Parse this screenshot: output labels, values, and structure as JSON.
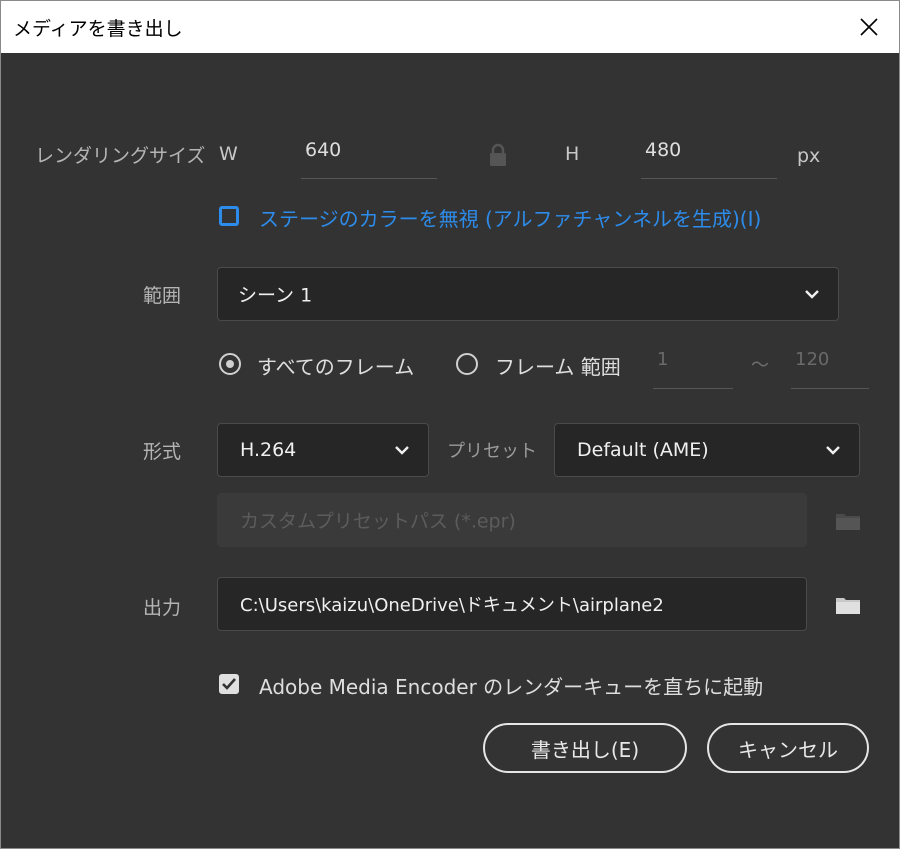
{
  "window": {
    "title": "メディアを書き出し",
    "close_glyph": "✕"
  },
  "render_size": {
    "label": "レンダリングサイズ",
    "w_label": "W",
    "w_value": "640",
    "h_label": "H",
    "h_value": "480",
    "unit": "px"
  },
  "ignore_stage_color": {
    "label": "ステージのカラーを無視 (アルファチャンネルを生成)(I)",
    "checked": false
  },
  "range": {
    "label": "範囲",
    "selected": "シーン 1",
    "all_frames_label": "すべてのフレーム",
    "frame_range_label": "フレーム 範囲",
    "range_start": "1",
    "range_tilde": "～",
    "range_end": "120"
  },
  "format": {
    "label": "形式",
    "selected": "H.264",
    "preset_label": "プリセット",
    "preset_selected": "Default (AME)",
    "custom_preset_placeholder": "カスタムプリセットパス (*.epr)"
  },
  "output": {
    "label": "出力",
    "path": "C:\\Users\\kaizu\\OneDrive\\ドキュメント\\airplane2"
  },
  "start_encoder": {
    "label": "Adobe Media Encoder のレンダーキューを直ちに起動",
    "checked": true
  },
  "buttons": {
    "export": "書き出し(E)",
    "cancel": "キャンセル"
  },
  "colors": {
    "background": "#333333",
    "accent": "#2d8ceb"
  }
}
